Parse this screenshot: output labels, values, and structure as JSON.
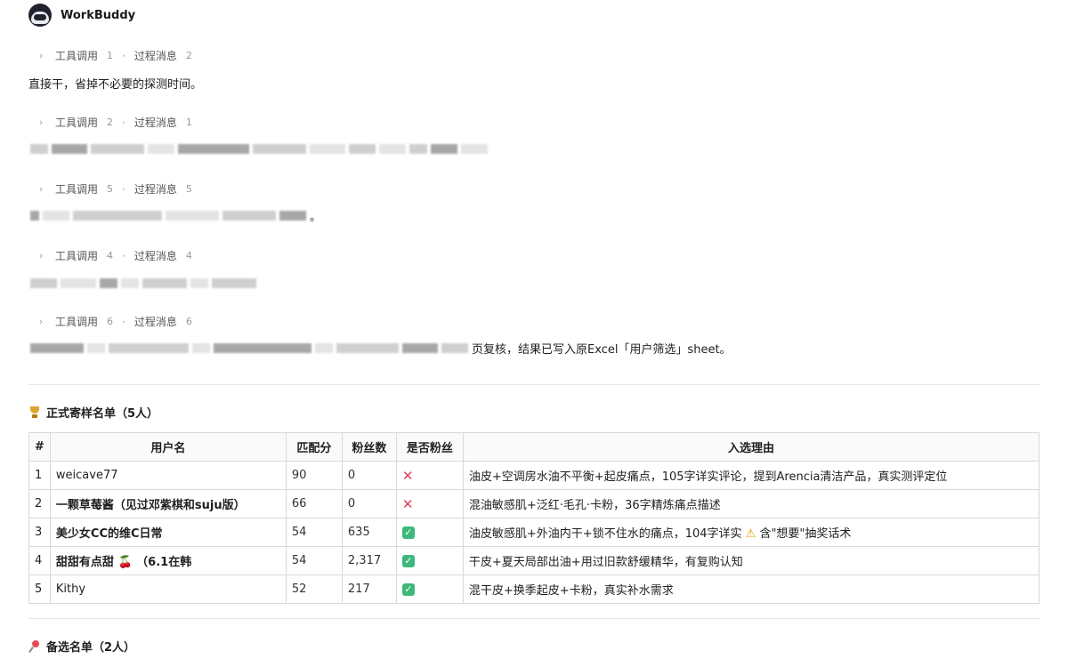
{
  "app": {
    "name": "WorkBuddy"
  },
  "labels": {
    "tool": "工具调用",
    "process": "过程消息"
  },
  "steps": [
    {
      "tool_count": "1",
      "process_count": "2",
      "message": "直接干，省掉不必要的探测时间。"
    },
    {
      "tool_count": "2",
      "process_count": "1"
    },
    {
      "tool_count": "5",
      "process_count": "5",
      "message_tail": "。"
    },
    {
      "tool_count": "4",
      "process_count": "4"
    },
    {
      "tool_count": "6",
      "process_count": "6",
      "message_tail": "页复核，结果已写入原Excel「用户筛选」sheet。"
    }
  ],
  "section1": {
    "title": "正式寄样名单（5人）"
  },
  "table": {
    "headers": [
      "#",
      "用户名",
      "匹配分",
      "粉丝数",
      "是否粉丝",
      "入选理由"
    ],
    "rows": [
      {
        "index": "1",
        "user": "weicave77",
        "score": "90",
        "fans": "0",
        "is_fan": false,
        "reason": "油皮+空调房水油不平衡+起皮痛点，105字详实评论，提到Arencia清洁产品，真实测评定位"
      },
      {
        "index": "2",
        "user": "一颗草莓酱（见过邓紫棋和suju版）",
        "score": "66",
        "fans": "0",
        "is_fan": false,
        "reason": "混油敏感肌+泛红·毛孔·卡粉，36字精炼痛点描述"
      },
      {
        "index": "3",
        "user": "美少女CC的维C日常",
        "score": "54",
        "fans": "635",
        "is_fan": true,
        "reason": "油皮敏感肌+外油内干+锁不住水的痛点，104字详实",
        "reason_warn": "含\"想要\"抽奖话术"
      },
      {
        "index": "4",
        "user": "甜甜有点甜",
        "user_suffix": "（6.1在韩",
        "score": "54",
        "fans": "2,317",
        "is_fan": true,
        "reason": "干皮+夏天局部出油+用过旧款舒缓精华，有复购认知"
      },
      {
        "index": "5",
        "user": "Kithy",
        "score": "52",
        "fans": "217",
        "is_fan": true,
        "reason": "混干皮+换季起皮+卡粉，真实补水需求"
      }
    ]
  },
  "section2": {
    "title": "备选名单（2人）"
  },
  "icons": {
    "fan_yes": "check-icon",
    "fan_no": "cross-icon",
    "warn": "warning-icon",
    "trophy": "trophy-icon",
    "pin": "pin-icon",
    "cherry": "cherry-icon"
  },
  "colors": {
    "check": "#3db87a",
    "cross": "#e0405e",
    "warn": "#e4a000"
  }
}
